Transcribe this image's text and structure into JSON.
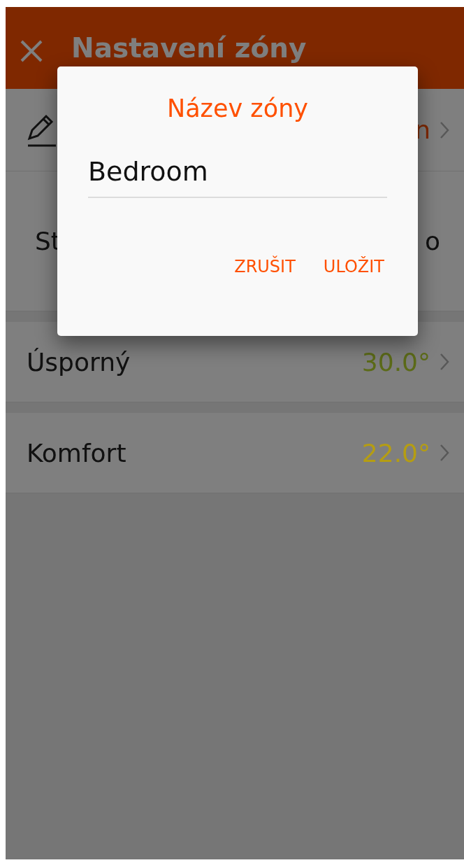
{
  "header": {
    "title": "Nastavení zóny"
  },
  "rows": [
    {
      "kind": "edit",
      "value": "n"
    },
    {
      "kind": "split",
      "label": "St",
      "value": "o"
    },
    {
      "kind": "temp",
      "label": "Úsporný",
      "value": "30.0°",
      "color": "#5c6b18"
    },
    {
      "kind": "temp",
      "label": "Komfort",
      "value": "22.0°",
      "color": "#b59d12"
    }
  ],
  "dialog": {
    "title": "Název zóny",
    "value": "Bedroom",
    "buttons": [
      "ZRUŠIT",
      "ULOŽIT"
    ]
  }
}
